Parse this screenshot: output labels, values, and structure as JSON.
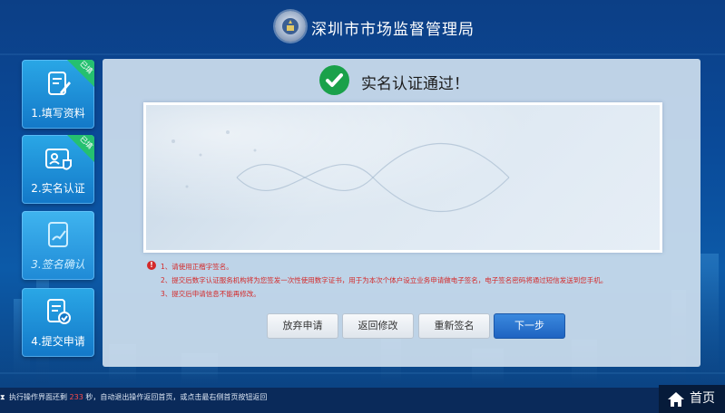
{
  "header": {
    "org_title": "深圳市市场监督管理局"
  },
  "sidebar": {
    "steps": [
      {
        "label": "1.填写资料",
        "badge": "已填",
        "icon": "form-edit-icon",
        "state": "done"
      },
      {
        "label": "2.实名认证",
        "badge": "已填",
        "icon": "id-card-verified-icon",
        "state": "done"
      },
      {
        "label": "3.签名确认",
        "badge": "",
        "icon": "tablet-sign-icon",
        "state": "active"
      },
      {
        "label": "4.提交申请",
        "badge": "",
        "icon": "document-check-icon",
        "state": "pending"
      }
    ]
  },
  "main": {
    "success_title": "实名认证通过！",
    "notices": [
      "1、请使用正楷字签名。",
      "2、提交后数字认证服务机构将为您签发一次性使用数字证书，用于为本次个体户设立业务申请做电子签名，电子签名密码将通过短信发送到您手机。",
      "3、提交后申请信息不能再修改。"
    ],
    "buttons": {
      "abandon": "放弃申请",
      "back": "返回修改",
      "resign": "重新签名",
      "next": "下一步"
    }
  },
  "footer": {
    "countdown_prefix": "执行操作界面还剩",
    "countdown_value": "233",
    "countdown_suffix": "秒，自动退出操作返回首页，或点击最右侧首页按钮返回",
    "home_label": "首页"
  },
  "colors": {
    "accent": "#1e63c1",
    "success": "#1aa14a",
    "warning": "#d42a2a",
    "badge": "#25c070"
  }
}
